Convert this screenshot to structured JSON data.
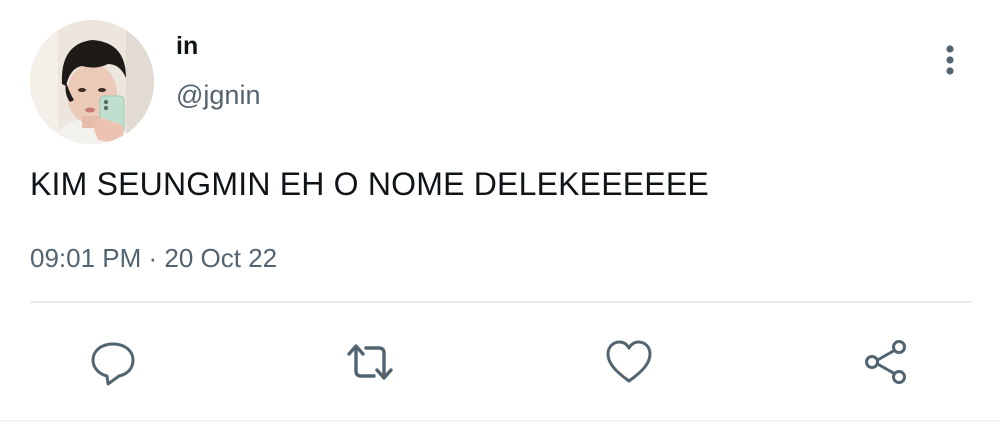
{
  "tweet": {
    "author": {
      "display_name": "in",
      "handle": "@jgnin",
      "avatar_icon": "profile-photo"
    },
    "text": "KIM SEUNGMIN EH O NOME DELEKEEEEEE",
    "timestamp": "09:01 PM · 20 Oct 22",
    "menu_icon": "more-vertical-icon",
    "actions": [
      {
        "name": "reply",
        "icon": "reply-icon"
      },
      {
        "name": "retweet",
        "icon": "retweet-icon"
      },
      {
        "name": "like",
        "icon": "heart-icon"
      },
      {
        "name": "share",
        "icon": "share-icon"
      }
    ],
    "colors": {
      "text": "#0f1419",
      "secondary": "#536471",
      "divider": "#e6ecf0"
    }
  }
}
